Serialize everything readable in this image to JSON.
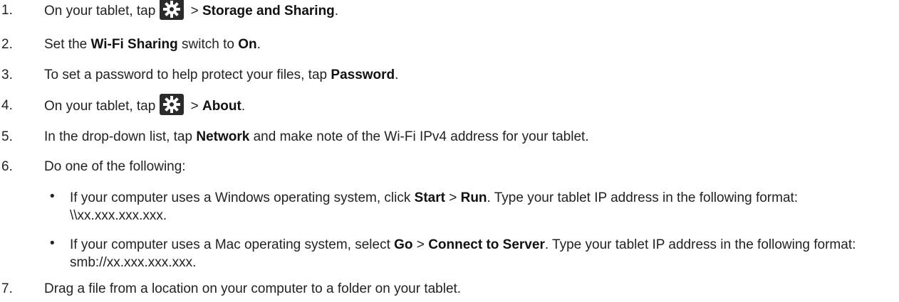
{
  "steps": [
    {
      "num": "1.",
      "t1": "On your tablet, tap",
      "t2": " > ",
      "b1": "Storage and Sharing",
      "t3": ".",
      "icon": "settings-gear-icon"
    },
    {
      "num": "2.",
      "t1": "Set the ",
      "b1": "Wi-Fi Sharing",
      "t2": " switch to ",
      "b2": "On",
      "t3": "."
    },
    {
      "num": "3.",
      "t1": "To set a password to help protect your files, tap ",
      "b1": "Password",
      "t2": "."
    },
    {
      "num": "4.",
      "t1": "On your tablet, tap",
      "t2": " > ",
      "b1": "About",
      "t3": ".",
      "icon": "settings-gear-icon"
    },
    {
      "num": "5.",
      "t1": "In the drop-down list, tap ",
      "b1": "Network",
      "t2": " and make note of the Wi-Fi IPv4 address for your tablet."
    },
    {
      "num": "6.",
      "t1": "Do one of the following:"
    },
    {
      "num": "7.",
      "t1": "Drag a file from a location on your computer to a folder on your tablet."
    }
  ],
  "bullets": [
    {
      "bullet": "•",
      "t1": "If your computer uses a Windows operating system, click ",
      "b1": "Start",
      "t2": " > ",
      "b2": "Run",
      "t3": ". Type your tablet IP address in the following format: \\\\xx.xxx.xxx.xxx."
    },
    {
      "bullet": "•",
      "t1": "If your computer uses a Mac operating system, select ",
      "b1": "Go",
      "t2": " > ",
      "b2": "Connect to Server",
      "t3": ". Type your tablet IP address in the following format: smb://xx.xxx.xxx.xxx."
    }
  ]
}
